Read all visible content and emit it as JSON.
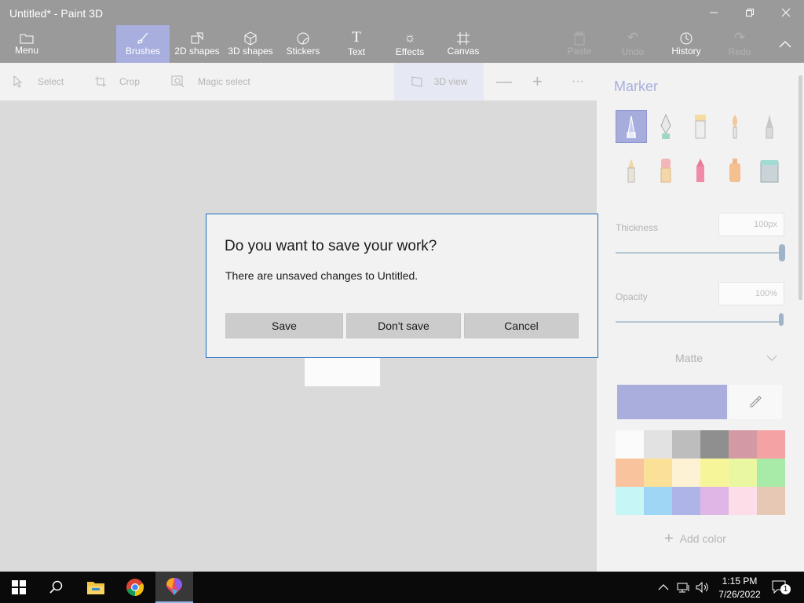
{
  "window": {
    "title": "Untitled* - Paint 3D"
  },
  "ribbon": {
    "menu_label": "Menu",
    "tools": [
      {
        "label": "Brushes",
        "icon": "brush-icon",
        "active": true
      },
      {
        "label": "2D shapes",
        "icon": "2d-shapes-icon"
      },
      {
        "label": "3D shapes",
        "icon": "3d-shapes-icon"
      },
      {
        "label": "Stickers",
        "icon": "stickers-icon"
      },
      {
        "label": "Text",
        "icon": "text-icon"
      },
      {
        "label": "Effects",
        "icon": "effects-icon"
      },
      {
        "label": "Canvas",
        "icon": "canvas-icon"
      }
    ],
    "paste_label": "Paste",
    "undo_label": "Undo",
    "history_label": "History",
    "redo_label": "Redo"
  },
  "commandbar": {
    "select_label": "Select",
    "crop_label": "Crop",
    "magic_select_label": "Magic select",
    "view3d_label": "3D view",
    "more_symbol": "···"
  },
  "panel": {
    "heading": "Marker",
    "brushes": [
      "marker",
      "calligraphy-pen",
      "oil-brush",
      "watercolor",
      "pixel-pen",
      "pencil",
      "eraser",
      "crayon",
      "spray-can",
      "fill"
    ],
    "thickness_label": "Thickness",
    "thickness_value": "100px",
    "thickness_level": 1.0,
    "opacity_label": "Opacity",
    "opacity_value": "100%",
    "opacity_level": 1.0,
    "finish_value": "Matte",
    "current_color": "#aaaedd",
    "palette": [
      "#fbfbfb",
      "#e2e2e2",
      "#bdbdbd",
      "#8f8f8f",
      "#d49aa3",
      "#f5a2a5",
      "#f9c49d",
      "#fbe197",
      "#fdf2d4",
      "#f7f59a",
      "#e9f8a0",
      "#a8eaa7",
      "#c7f6f7",
      "#9fd6f5",
      "#aeb4e8",
      "#e0b6e6",
      "#fddde8",
      "#e6c8b4"
    ],
    "add_color_label": "Add color"
  },
  "dialog": {
    "title": "Do you want to save your work?",
    "message": "There are unsaved changes to Untitled.",
    "save_label": "Save",
    "dont_save_label": "Don't save",
    "cancel_label": "Cancel"
  },
  "taskbar": {
    "apps": [
      "file-explorer",
      "chrome",
      "paint-3d"
    ],
    "time": "1:15 PM",
    "date": "7/26/2022",
    "notification_count": "1"
  }
}
